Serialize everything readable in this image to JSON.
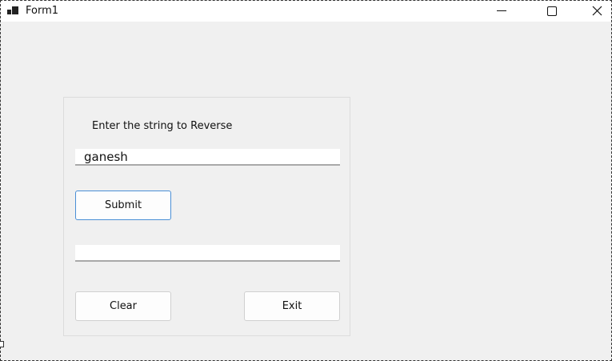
{
  "window": {
    "title": "Form1"
  },
  "form": {
    "prompt_label": "Enter the string to Reverse",
    "input_value": "ganesh",
    "output_value": "",
    "submit_label": "Submit",
    "clear_label": "Clear",
    "exit_label": "Exit"
  },
  "icons": {
    "app": "app-window-icon",
    "minimize": "minimize-icon",
    "maximize": "maximize-icon",
    "close": "close-icon"
  }
}
